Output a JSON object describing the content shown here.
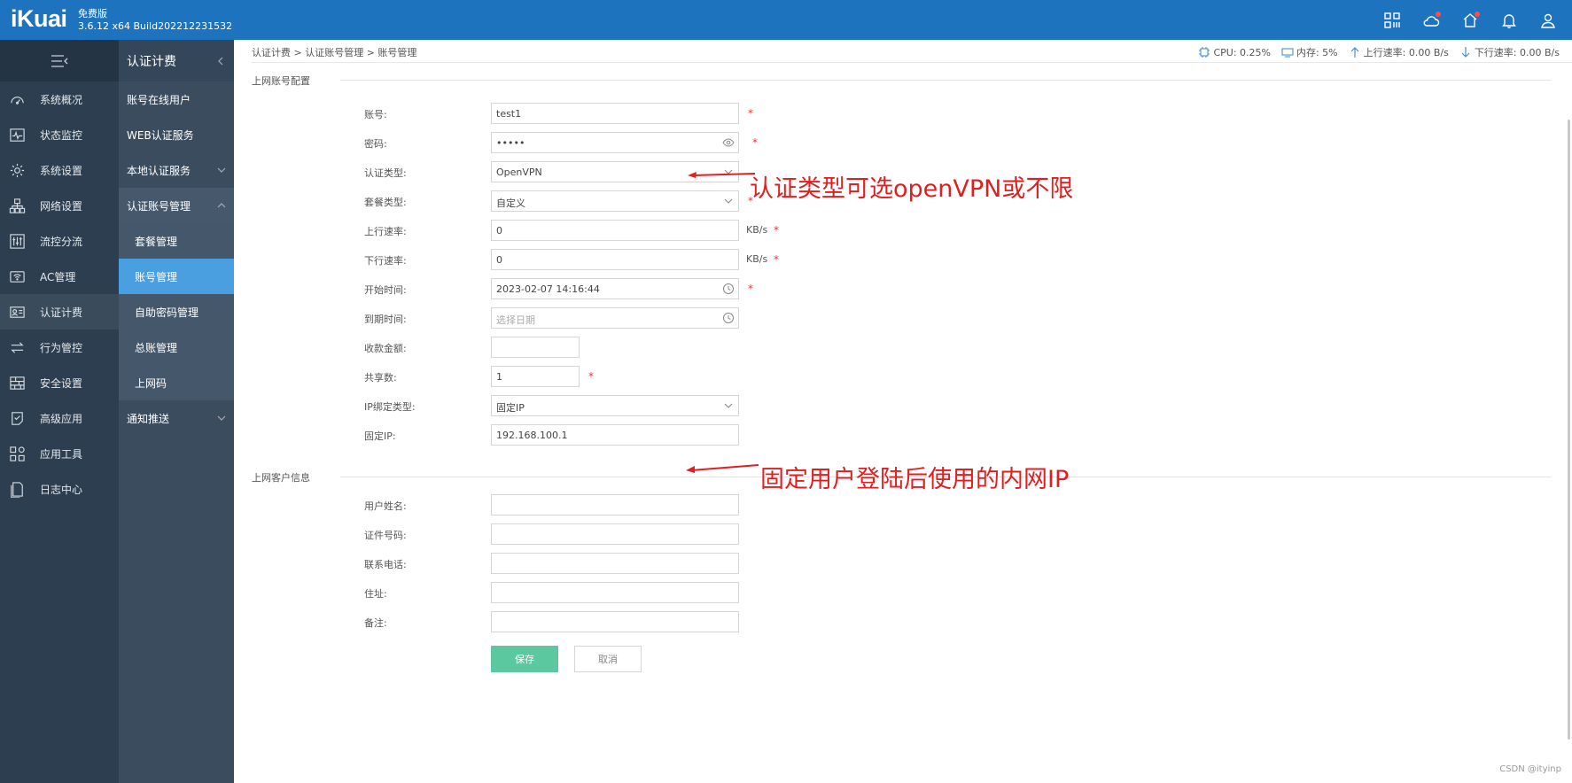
{
  "header": {
    "logo": "iKuai",
    "edition": "免费版",
    "version": "3.6.12 x64 Build202212231532",
    "icons": [
      "apps-icon",
      "cloud-icon",
      "home-icon",
      "bell-icon",
      "user-icon"
    ]
  },
  "nav": {
    "items": [
      {
        "label": "系统概况",
        "icon": "dashboard-icon"
      },
      {
        "label": "状态监控",
        "icon": "monitor-icon"
      },
      {
        "label": "系统设置",
        "icon": "gear-icon"
      },
      {
        "label": "网络设置",
        "icon": "network-icon"
      },
      {
        "label": "流控分流",
        "icon": "sliders-icon"
      },
      {
        "label": "AC管理",
        "icon": "wifi-icon"
      },
      {
        "label": "认证计费",
        "icon": "id-card-icon"
      },
      {
        "label": "行为管控",
        "icon": "swap-icon"
      },
      {
        "label": "安全设置",
        "icon": "firewall-icon"
      },
      {
        "label": "高级应用",
        "icon": "check-doc-icon"
      },
      {
        "label": "应用工具",
        "icon": "tools-icon"
      },
      {
        "label": "日志中心",
        "icon": "log-icon"
      }
    ]
  },
  "subnav": {
    "title": "认证计费",
    "items": [
      {
        "label": "账号在线用户"
      },
      {
        "label": "WEB认证服务"
      },
      {
        "label": "本地认证服务"
      },
      {
        "label": "认证账号管理"
      },
      {
        "label": "套餐管理"
      },
      {
        "label": "账号管理"
      },
      {
        "label": "自助密码管理"
      },
      {
        "label": "总账管理"
      },
      {
        "label": "上网码"
      },
      {
        "label": "通知推送"
      }
    ]
  },
  "breadcrumb": "认证计费 > 认证账号管理 > 账号管理",
  "stats": {
    "cpu": "CPU: 0.25%",
    "mem": "内存: 5%",
    "up": "上行速率: 0.00 B/s",
    "down": "下行速率: 0.00 B/s"
  },
  "section1": {
    "title": "上网账号配置",
    "fields": {
      "account": {
        "label": "账号:",
        "value": "test1"
      },
      "password": {
        "label": "密码:",
        "value": "•••••"
      },
      "auth_type": {
        "label": "认证类型:",
        "value": "OpenVPN"
      },
      "plan_type": {
        "label": "套餐类型:",
        "value": "自定义"
      },
      "up_rate": {
        "label": "上行速率:",
        "value": "0",
        "unit": "KB/s"
      },
      "down_rate": {
        "label": "下行速率:",
        "value": "0",
        "unit": "KB/s"
      },
      "start_time": {
        "label": "开始时间:",
        "value": "2023-02-07 14:16:44"
      },
      "end_time": {
        "label": "到期时间:",
        "placeholder": "选择日期"
      },
      "amount": {
        "label": "收款金额:",
        "value": ""
      },
      "share": {
        "label": "共享数:",
        "value": "1"
      },
      "ip_bind": {
        "label": "IP绑定类型:",
        "value": "固定IP"
      },
      "fixed_ip": {
        "label": "固定IP:",
        "value": "192.168.100.1"
      }
    }
  },
  "section2": {
    "title": "上网客户信息",
    "fields": {
      "name": {
        "label": "用户姓名:",
        "value": ""
      },
      "id_no": {
        "label": "证件号码:",
        "value": ""
      },
      "phone": {
        "label": "联系电话:",
        "value": ""
      },
      "address": {
        "label": "住址:",
        "value": ""
      },
      "note": {
        "label": "备注:",
        "value": ""
      }
    }
  },
  "buttons": {
    "save": "保存",
    "cancel": "取消"
  },
  "annotations": {
    "auth_note": "认证类型可选openVPN或不限",
    "ip_note": "固定用户登陆后使用的内网IP"
  },
  "required_mark": "*",
  "watermark": "CSDN @ityinp",
  "colors": {
    "topbar": "#1e73be",
    "selected": "#4a9fe0",
    "save": "#5bc8a0",
    "annotation": "#e02020"
  }
}
